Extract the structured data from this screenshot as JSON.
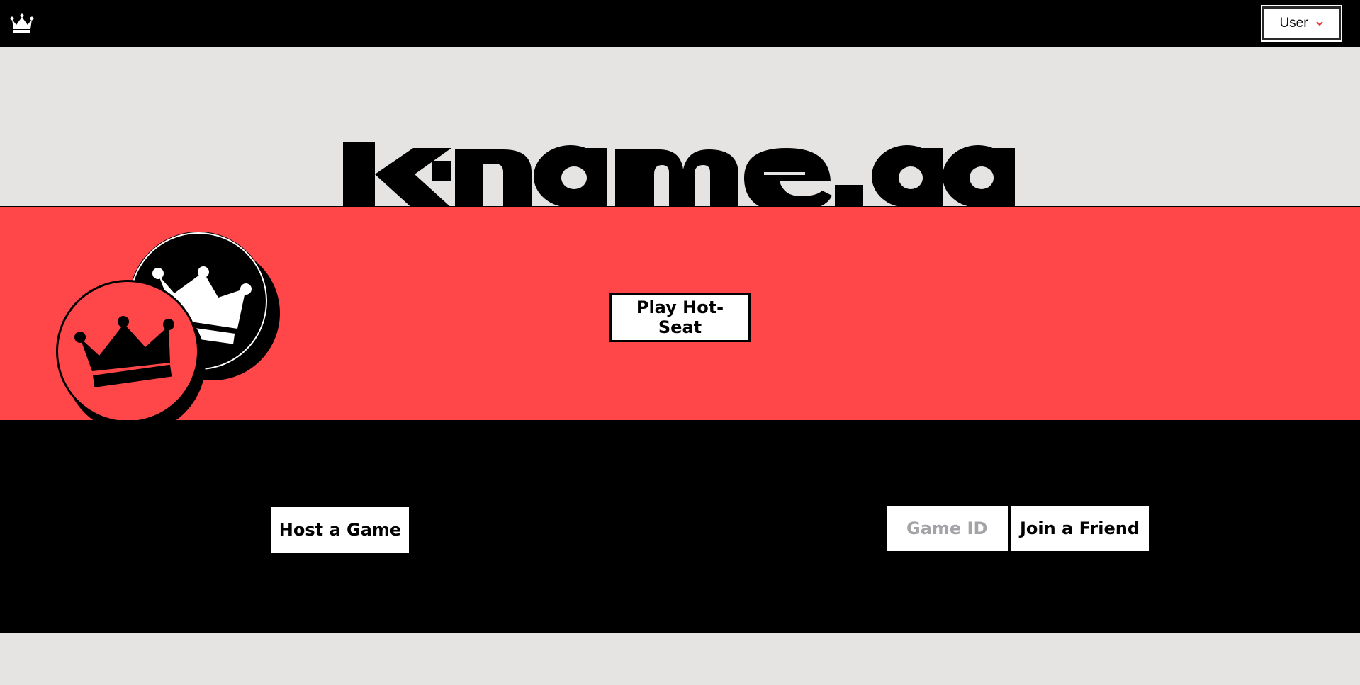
{
  "nav": {
    "logo_icon": "crown-icon",
    "user_menu": {
      "label": "User",
      "icon": "chevron-down-icon",
      "icon_color": "#e03a3c"
    }
  },
  "hero": {
    "wordmark": "kingme.gg"
  },
  "hotseat": {
    "button_label": "Play Hot-Seat",
    "band_color": "#ff4649"
  },
  "online": {
    "host_button_label": "Host a Game",
    "game_id_placeholder": "Game ID",
    "game_id_value": "",
    "join_button_label": "Join a Friend"
  }
}
